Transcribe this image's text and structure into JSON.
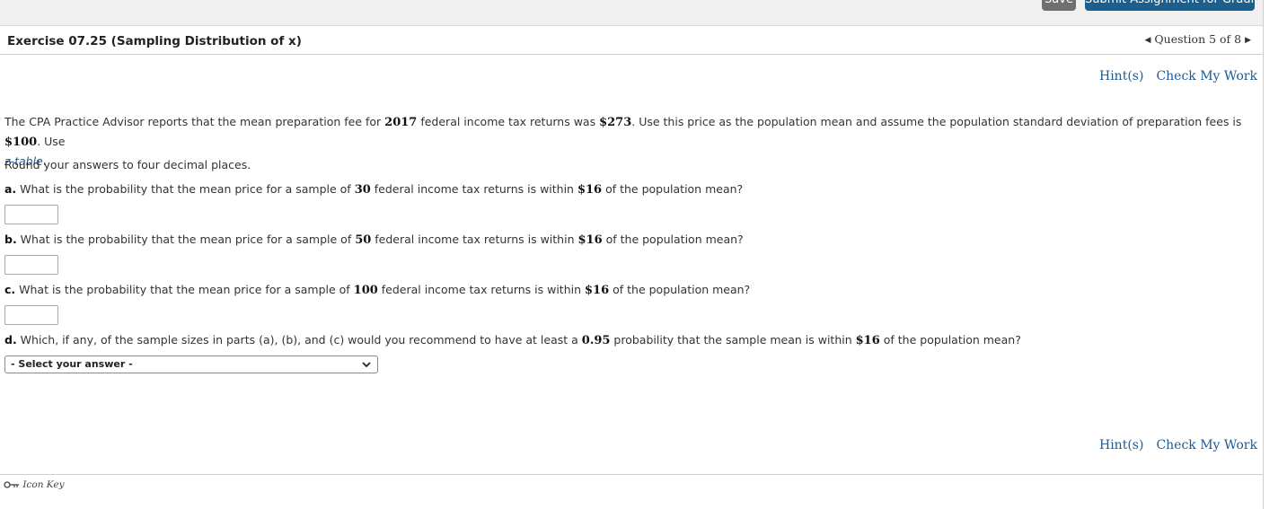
{
  "toolbar": {
    "save_label": "Save",
    "submit_label": "Submit Assignment for Grading"
  },
  "header": {
    "exercise_title": "Exercise 07.25 (Sampling Distribution of x)",
    "question_nav": "Question 5 of 8",
    "prev_icon": "triangle-left-icon",
    "next_icon": "triangle-right-icon"
  },
  "help": {
    "hint_label": "Hint(s)",
    "check_label": "Check My Work"
  },
  "problem": {
    "intro_1": "The CPA Practice Advisor reports that the mean preparation fee for ",
    "year": "2017",
    "intro_2": " federal income tax returns was ",
    "mean_fee": "$273",
    "intro_3": ". Use this price as the population mean and assume the population standard deviation of preparation fees is ",
    "std_dev": "$100",
    "intro_4": ". Use ",
    "z_table_link": "z-table",
    "intro_5": ".",
    "rounding": "Round your answers to four decimal places."
  },
  "questions": [
    {
      "label": "a.",
      "pre": " What is the probability that the mean price for a sample of ",
      "n": "30",
      "mid": " federal income tax returns is within ",
      "amount": "$16",
      "post": " of the population mean?",
      "answer_value": ""
    },
    {
      "label": "b.",
      "pre": " What is the probability that the mean price for a sample of ",
      "n": "50",
      "mid": " federal income tax returns is within ",
      "amount": "$16",
      "post": " of the population mean?",
      "answer_value": ""
    },
    {
      "label": "c.",
      "pre": " What is the probability that the mean price for a sample of ",
      "n": "100",
      "mid": " federal income tax returns is within ",
      "amount": "$16",
      "post": " of the population mean?",
      "answer_value": ""
    }
  ],
  "question_d": {
    "label": "d.",
    "pre": " Which, if any, of the sample sizes in parts (a), (b), and (c) would you recommend to have at least a ",
    "prob": "0.95",
    "mid": " probability that the sample mean is within ",
    "amount": "$16",
    "post": " of the population mean?",
    "select_value": "- Select your answer -"
  },
  "footer": {
    "icon_key_label": "Icon Key",
    "icon": "key-icon"
  }
}
